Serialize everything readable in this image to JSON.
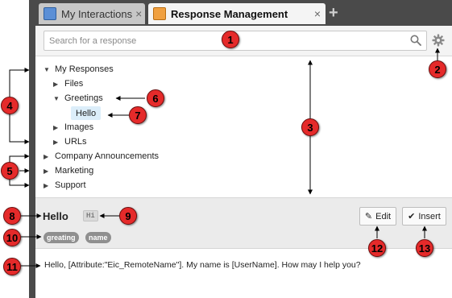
{
  "tabs": [
    {
      "label": "My Interactions",
      "icon": "interactions-icon",
      "active": false
    },
    {
      "label": "Response Management",
      "icon": "response-management-icon",
      "active": true
    }
  ],
  "tab_close_glyph": "×",
  "add_tab_glyph": "+",
  "search": {
    "placeholder": "Search for a response",
    "value": ""
  },
  "tree": {
    "items": [
      {
        "label": "My Responses",
        "expanded": true,
        "level": 0
      },
      {
        "label": "Files",
        "expanded": false,
        "level": 1
      },
      {
        "label": "Greetings",
        "expanded": true,
        "level": 1
      },
      {
        "label": "Hello",
        "selected": true,
        "level": 2
      },
      {
        "label": "Images",
        "expanded": false,
        "level": 1
      },
      {
        "label": "URLs",
        "expanded": false,
        "level": 1
      },
      {
        "label": "Company Announcements",
        "expanded": false,
        "level": 0
      },
      {
        "label": "Marketing",
        "expanded": false,
        "level": 0
      },
      {
        "label": "Support",
        "expanded": false,
        "level": 0
      }
    ]
  },
  "detail": {
    "title": "Hello",
    "shortcut": "Hi",
    "tags": [
      "greating",
      "name"
    ],
    "edit_label": "Edit",
    "insert_label": "Insert",
    "body_text": "Hello, [Attribute:\"Eic_RemoteName\"]. My name is [UserName]. How may I help you?"
  },
  "callouts": [
    "1",
    "2",
    "3",
    "4",
    "5",
    "6",
    "7",
    "8",
    "9",
    "10",
    "11",
    "12",
    "13"
  ],
  "colors": {
    "callout_fill": "#e52a2a",
    "chrome_dark": "#4a4a4a",
    "selected_item": "#dceefa",
    "tag_fill": "#8f8f8f"
  }
}
